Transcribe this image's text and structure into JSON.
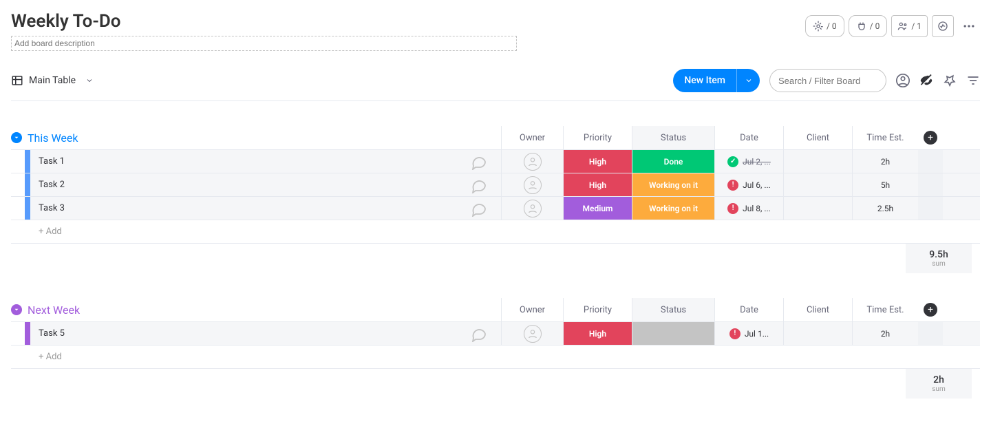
{
  "board": {
    "title": "Weekly To-Do",
    "description_placeholder": "Add board description"
  },
  "header_pills": {
    "automations": "/ 0",
    "integrations": "/ 0",
    "members": "/ 1"
  },
  "view": {
    "name": "Main Table"
  },
  "toolbar": {
    "new_item": "New Item",
    "search_placeholder": "Search / Filter Board"
  },
  "columns": [
    "Owner",
    "Priority",
    "Status",
    "Date",
    "Client",
    "Time Est."
  ],
  "colors": {
    "high": "#e2445c",
    "medium": "#a25ddc",
    "done": "#00c875",
    "working": "#fdab3d",
    "empty": "#c4c4c4",
    "blue": "#579bfc",
    "purple": "#a25ddc",
    "done_dot": "#00c875",
    "warn_dot": "#e2445c"
  },
  "groups": [
    {
      "name": "This Week",
      "color": "#579bfc",
      "name_color": "#0085ff",
      "collapse_color": "#0085ff",
      "rows": [
        {
          "name": "Task 1",
          "priority": "High",
          "priority_color": "high",
          "status": "Done",
          "status_color": "done",
          "date": "Jul 2, ...",
          "date_state": "done",
          "time": "2h"
        },
        {
          "name": "Task 2",
          "priority": "High",
          "priority_color": "high",
          "status": "Working on it",
          "status_color": "working",
          "date": "Jul 6, ...",
          "date_state": "warn",
          "time": "5h"
        },
        {
          "name": "Task 3",
          "priority": "Medium",
          "priority_color": "medium",
          "status": "Working on it",
          "status_color": "working",
          "date": "Jul 8, ...",
          "date_state": "warn",
          "time": "2.5h"
        }
      ],
      "add_label": "+ Add",
      "sum": {
        "value": "9.5h",
        "label": "sum"
      }
    },
    {
      "name": "Next Week",
      "color": "#a25ddc",
      "name_color": "#a25ddc",
      "collapse_color": "#a25ddc",
      "rows": [
        {
          "name": "Task 5",
          "priority": "High",
          "priority_color": "high",
          "status": "",
          "status_color": "empty",
          "date": "Jul 1...",
          "date_state": "warn",
          "time": "2h"
        }
      ],
      "add_label": "+ Add",
      "sum": {
        "value": "2h",
        "label": "sum"
      }
    }
  ]
}
